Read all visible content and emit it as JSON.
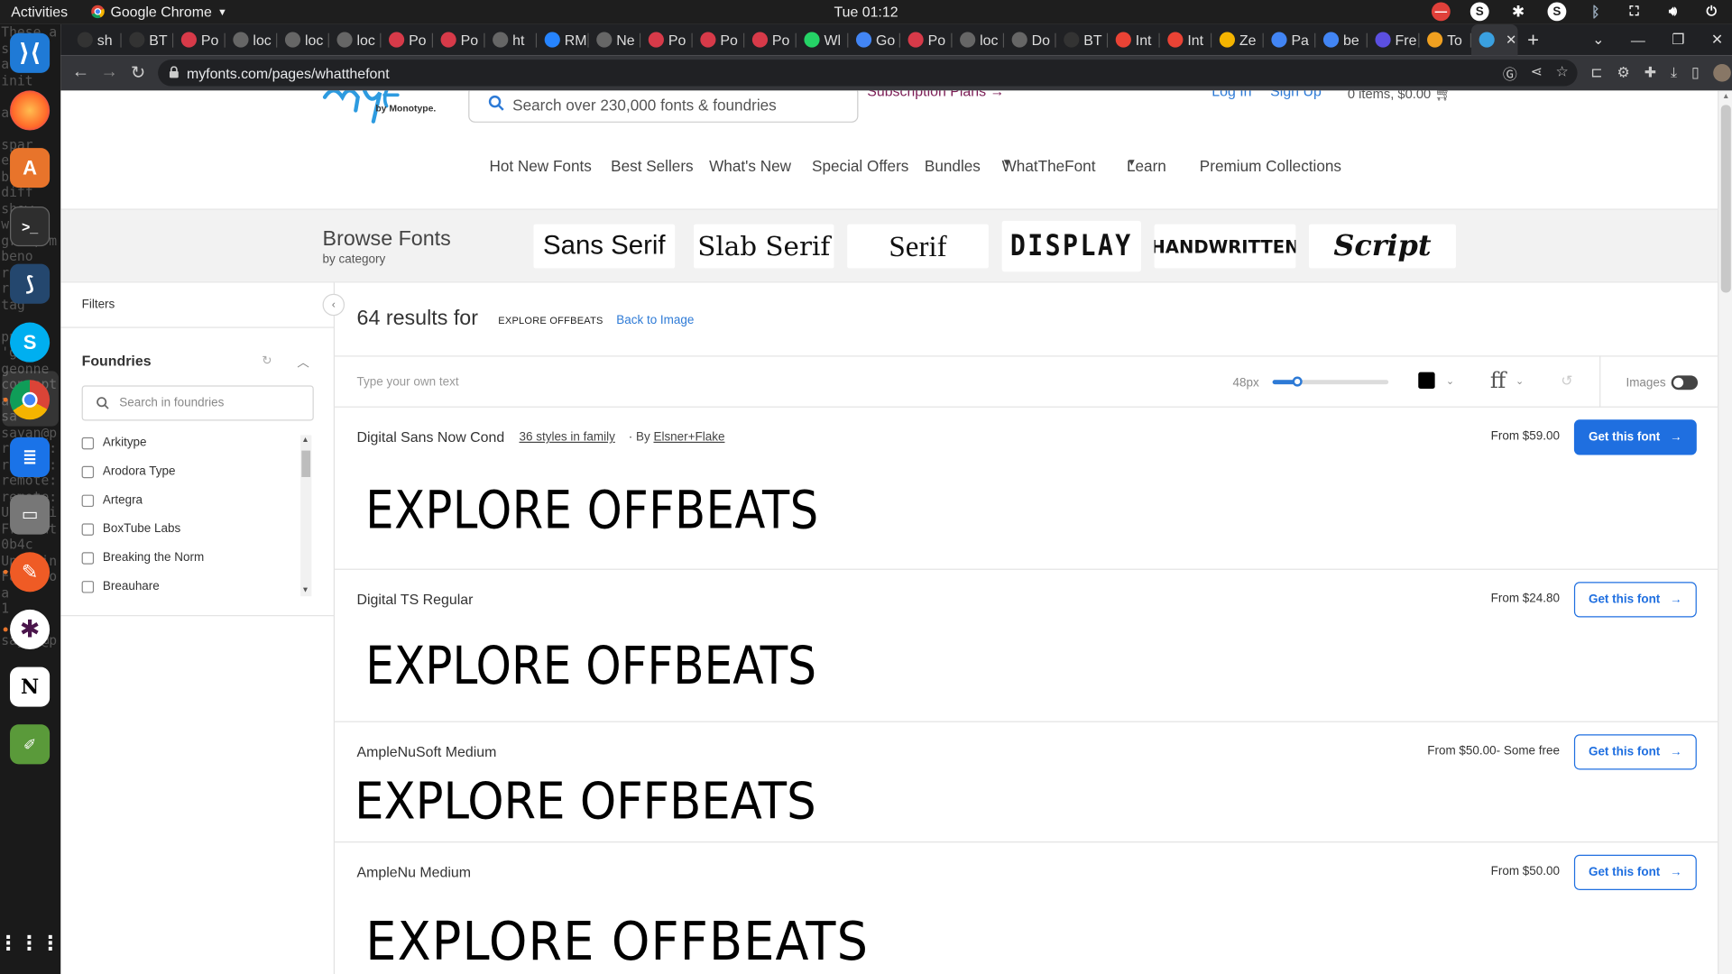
{
  "topbar": {
    "activities": "Activities",
    "app_name": "Google Chrome",
    "clock": "Tue 01:12"
  },
  "dock": {
    "terminal_lines": [
      "These a",
      "s",
      "ate",
      "init",
      "",
      "add",
      "",
      "spar",
      "exe",
      "bise",
      "diff",
      "show",
      "with",
      "grow, m",
      "beno",
      "reba",
      "rese",
      "tag",
      "",
      "pull",
      "'git",
      "geonne",
      "concept",
      "ad",
      "sa",
      "sayan@p",
      "remote:",
      "remote:",
      "remote:",
      "remote:",
      "Unpacki",
      "From ht",
      "0b4c",
      "Updatin",
      "Fast-fo",
      "a",
      "1",
      "",
      "sayan@p"
    ]
  },
  "chrome": {
    "tabs": [
      {
        "label": "sh",
        "icon": "github-icon",
        "color": "#333333"
      },
      {
        "label": "BT",
        "icon": "github-icon",
        "color": "#333333"
      },
      {
        "label": "Po",
        "icon": "pocket-icon",
        "color": "#d73a49"
      },
      {
        "label": "loc",
        "icon": "folder-icon",
        "color": "#666666"
      },
      {
        "label": "loc",
        "icon": "globe-icon",
        "color": "#666666"
      },
      {
        "label": "loc",
        "icon": "globe-icon",
        "color": "#666666"
      },
      {
        "label": "Po",
        "icon": "pocket-icon",
        "color": "#d73a49"
      },
      {
        "label": "Po",
        "icon": "pocket-icon",
        "color": "#d73a49"
      },
      {
        "label": "ht",
        "icon": "globe-icon",
        "color": "#666666"
      },
      {
        "label": "RM",
        "icon": "jira-icon",
        "color": "#2684ff"
      },
      {
        "label": "Ne",
        "icon": "globe-icon",
        "color": "#666666"
      },
      {
        "label": "Po",
        "icon": "pocket-icon",
        "color": "#d73a49"
      },
      {
        "label": "Po",
        "icon": "pocket-icon",
        "color": "#d73a49"
      },
      {
        "label": "Po",
        "icon": "pocket-icon",
        "color": "#d73a49"
      },
      {
        "label": "Wl",
        "icon": "whatsapp-icon",
        "color": "#25d366"
      },
      {
        "label": "Go",
        "icon": "google-icon",
        "color": "#4285f4"
      },
      {
        "label": "Po",
        "icon": "pocket-icon",
        "color": "#d73a49"
      },
      {
        "label": "loc",
        "icon": "globe-icon",
        "color": "#666666"
      },
      {
        "label": "Do",
        "icon": "download-icon",
        "color": "#666666"
      },
      {
        "label": "BT",
        "icon": "github-icon",
        "color": "#333333"
      },
      {
        "label": "Int",
        "icon": "gmail-icon",
        "color": "#ea4335"
      },
      {
        "label": "Int",
        "icon": "gmail-icon",
        "color": "#ea4335"
      },
      {
        "label": "Ze",
        "icon": "pinwheel-icon",
        "color": "#f4b400"
      },
      {
        "label": "Pa",
        "icon": "google-icon",
        "color": "#4285f4"
      },
      {
        "label": "be",
        "icon": "google-icon",
        "color": "#4285f4"
      },
      {
        "label": "Fre",
        "icon": "app-icon",
        "color": "#5b4fe0"
      },
      {
        "label": "To",
        "icon": "app-icon",
        "color": "#f0a020"
      },
      {
        "label": "",
        "icon": "myfonts-icon",
        "color": "#3aa0e0",
        "active": true
      }
    ],
    "close_tab": "✕",
    "new_tab": "+",
    "url": "myfonts.com/pages/whatthefont"
  },
  "site": {
    "search_placeholder": "Search over 230,000 fonts & foundries",
    "subscription": "Subscription Plans",
    "login": "Log In",
    "signup": "Sign Up",
    "cart": "0 items, $0.00",
    "logo_by": "by Monotype.",
    "nav": [
      "Hot New Fonts",
      "Best Sellers",
      "What's New",
      "Special Offers",
      "Bundles",
      "WhatTheFont",
      "Learn",
      "Premium Collections"
    ],
    "browse_title": "Browse Fonts",
    "browse_sub": "by category",
    "categories": [
      "Sans Serif",
      "Slab Serif",
      "Serif",
      "DISPLAY",
      "HANDWRITTEN",
      "Script"
    ]
  },
  "sidebar": {
    "filters": "Filters",
    "foundries": "Foundries",
    "search_placeholder": "Search in foundries",
    "items": [
      "Arkitype",
      "Arodora Type",
      "Artegra",
      "BoxTube Labs",
      "Breaking the Norm",
      "Breauhare"
    ]
  },
  "results": {
    "count_text": "64 results for",
    "sample_text": "EXPLORE OFFBEATS",
    "back_link": "Back to Image",
    "type_placeholder": "Type your own text",
    "size": "48px",
    "size_fraction": 0.21,
    "images_label": "Images",
    "images_on": false,
    "fonts": [
      {
        "name": "Digital Sans Now Cond",
        "styles": "36 styles in family",
        "by_prefix": "By",
        "foundry": "Elsner+Flake",
        "price": "From $59.00",
        "button": "Get this font"
      },
      {
        "name": "Digital TS Regular",
        "styles": "",
        "by_prefix": "",
        "foundry": "",
        "price": "From $24.80",
        "button": "Get this font"
      },
      {
        "name": "AmpleNuSoft Medium",
        "styles": "",
        "by_prefix": "",
        "foundry": "",
        "price": "From $50.00- Some free",
        "button": "Get this font"
      },
      {
        "name": "AmpleNu Medium",
        "styles": "",
        "by_prefix": "",
        "foundry": "",
        "price": "From $50.00",
        "button": "Get this font"
      }
    ]
  },
  "colors": {
    "accent": "#1f6fe0",
    "link": "#2d7ad6",
    "subscription": "#7b1c55"
  }
}
